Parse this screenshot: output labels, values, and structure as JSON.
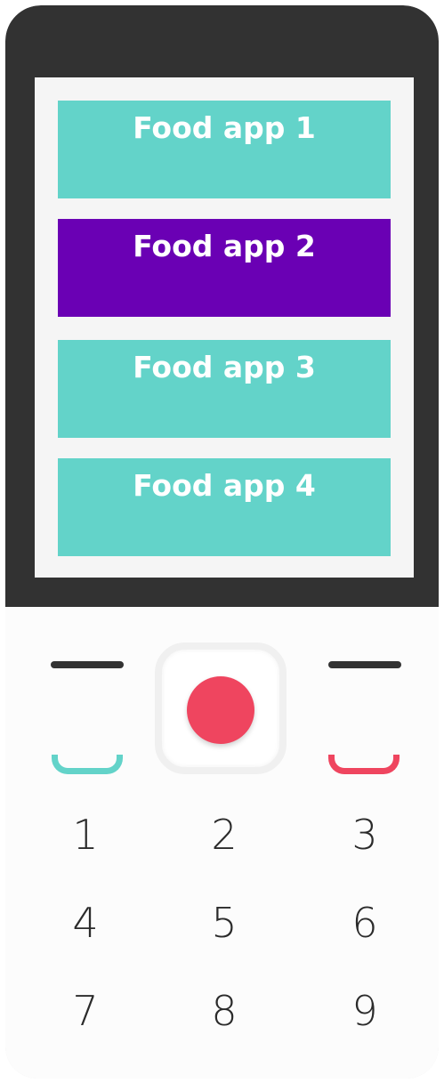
{
  "screen": {
    "apps": [
      {
        "label": "Food app 1",
        "selected": false
      },
      {
        "label": "Food app 2",
        "selected": true
      },
      {
        "label": "Food app 3",
        "selected": false
      },
      {
        "label": "Food app 4",
        "selected": false
      }
    ]
  },
  "keypad": {
    "keys": [
      "1",
      "2",
      "3",
      "4",
      "5",
      "6",
      "7",
      "8",
      "9"
    ]
  },
  "colors": {
    "app_tile": "#63d3c9",
    "app_tile_selected": "#6a00b4",
    "call_accept": "#63d3c9",
    "call_end": "#ef455f",
    "center_button": "#ef455f"
  },
  "icons": {
    "left_soft_key": "soft-key-line-icon",
    "right_soft_key": "soft-key-line-icon",
    "call_accept": "call-accept-icon",
    "call_end": "call-end-icon"
  }
}
